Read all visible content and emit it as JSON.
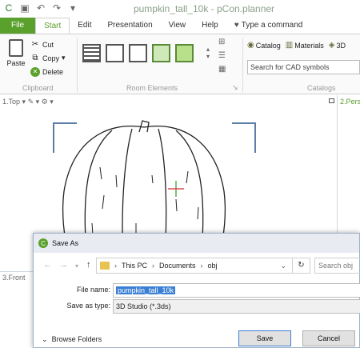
{
  "window": {
    "title": "pumpkin_tall_10k - pCon.planner"
  },
  "quick_access": [
    {
      "name": "app-icon",
      "glyph": "C"
    },
    {
      "name": "save-icon",
      "glyph": "▣"
    },
    {
      "name": "undo-icon",
      "glyph": "↶"
    },
    {
      "name": "redo-icon",
      "glyph": "↷"
    },
    {
      "name": "customize-icon",
      "glyph": "▾"
    }
  ],
  "tabs": [
    "File",
    "Start",
    "Edit",
    "Presentation",
    "View",
    "Help"
  ],
  "tell_me": "Type a command",
  "clipboard": {
    "paste": "Paste",
    "cut": "Cut",
    "copy": "Copy",
    "delete": "Delete",
    "group": "Clipboard"
  },
  "room_elements": {
    "group": "Room Elements"
  },
  "catalogs": {
    "catalog": "Catalog",
    "materials": "Materials",
    "threed": "3D",
    "search_placeholder": "Search for CAD symbols",
    "group": "Catalogs"
  },
  "viewports": {
    "top_left": "1.Top",
    "top_right": "2.Pers",
    "bottom_left": "3.Front"
  },
  "dialog": {
    "title": "Save As",
    "path": [
      "This PC",
      "Documents",
      "obj"
    ],
    "search_placeholder": "Search obj",
    "file_name_label": "File name:",
    "file_name_value": "pumpkin_tall_10k",
    "save_type_label": "Save as type:",
    "save_type_value": "3D Studio (*.3ds)",
    "browse_folders": "Browse Folders",
    "save": "Save",
    "cancel": "Cancel"
  },
  "colors": {
    "accent": "#5aa02c",
    "viewport_frame": "#5b7da6"
  }
}
